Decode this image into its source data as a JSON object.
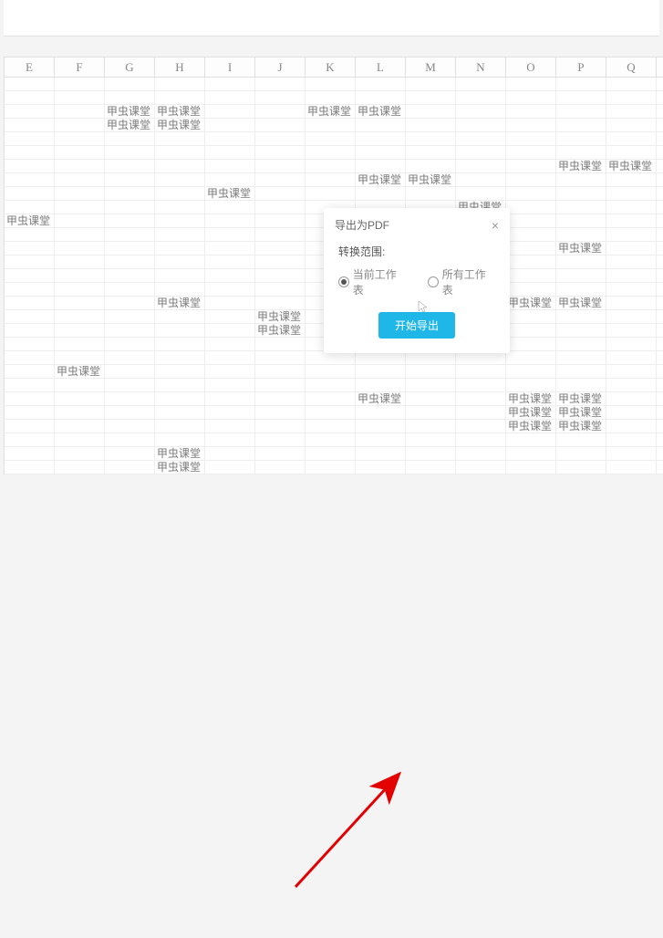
{
  "columns": [
    "E",
    "F",
    "G",
    "H",
    "I",
    "J",
    "K",
    "L",
    "M",
    "N",
    "O",
    "P",
    "Q",
    ""
  ],
  "cell_text": "甲虫课堂",
  "cells": {
    "r3": {
      "G": true,
      "H": true,
      "K": true,
      "L": true
    },
    "r4": {
      "G": true,
      "H": true
    },
    "r7": {
      "P": true,
      "Q": true
    },
    "r8": {
      "L": true,
      "M": true
    },
    "r9": {
      "I": true
    },
    "r10": {
      "N": true
    },
    "r11": {
      "E": true
    },
    "r13": {
      "P": true
    },
    "r17": {
      "H": true,
      "O": true,
      "P": true
    },
    "r18": {
      "J": true
    },
    "r19": {
      "J": true
    },
    "r22": {
      "F": true
    },
    "r24": {
      "L": true,
      "O": true,
      "P": true
    },
    "r25": {
      "O": true,
      "P": true
    },
    "r26": {
      "O": true,
      "P": true
    },
    "r28": {
      "H": true
    },
    "r29": {
      "H": true
    }
  },
  "dialog": {
    "title": "导出为PDF",
    "close": "×",
    "range_label": "转换范围:",
    "option_current": "当前工作表",
    "option_all": "所有工作表",
    "button": "开始导出"
  }
}
